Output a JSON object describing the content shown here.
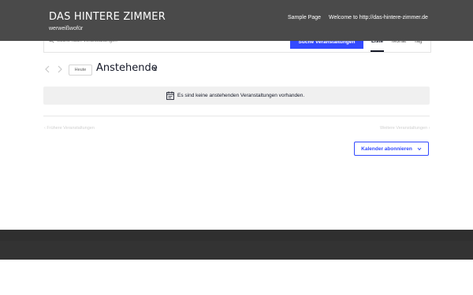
{
  "site": {
    "title": "DAS HINTERE ZIMMER",
    "tagline": "werweißwofür"
  },
  "nav": {
    "items": [
      {
        "label": "Sample Page"
      },
      {
        "label": "Welcome to http://das-hintere-zimmer.de"
      }
    ]
  },
  "events_bar": {
    "search_placeholder": "Suche nach Veranstaltungen",
    "search_button": "Suche Veranstaltungen",
    "views": [
      {
        "label": "Liste",
        "active": true
      },
      {
        "label": "Monat",
        "active": false
      },
      {
        "label": "Tag",
        "active": false
      }
    ]
  },
  "top_bar": {
    "today_label": "Heute",
    "datepicker_label": "Anstehende"
  },
  "notice": {
    "text": "Es sind keine anstehenden Veranstaltungen vorhanden."
  },
  "nav_footer": {
    "prev_label": "Frühere Veranstaltungen",
    "next_label": "Weitere Veranstaltungen"
  },
  "subscribe": {
    "label": "Kalender abonnieren"
  },
  "colors": {
    "header_bg": "#4a4a4a",
    "accent": "#334aff",
    "notice_bg": "#f0f0f0",
    "footer_bg": "#2f2f2f"
  },
  "icons": [
    "search-icon",
    "chevron-left-icon",
    "chevron-right-icon",
    "chevron-down-icon",
    "calendar-icon"
  ]
}
